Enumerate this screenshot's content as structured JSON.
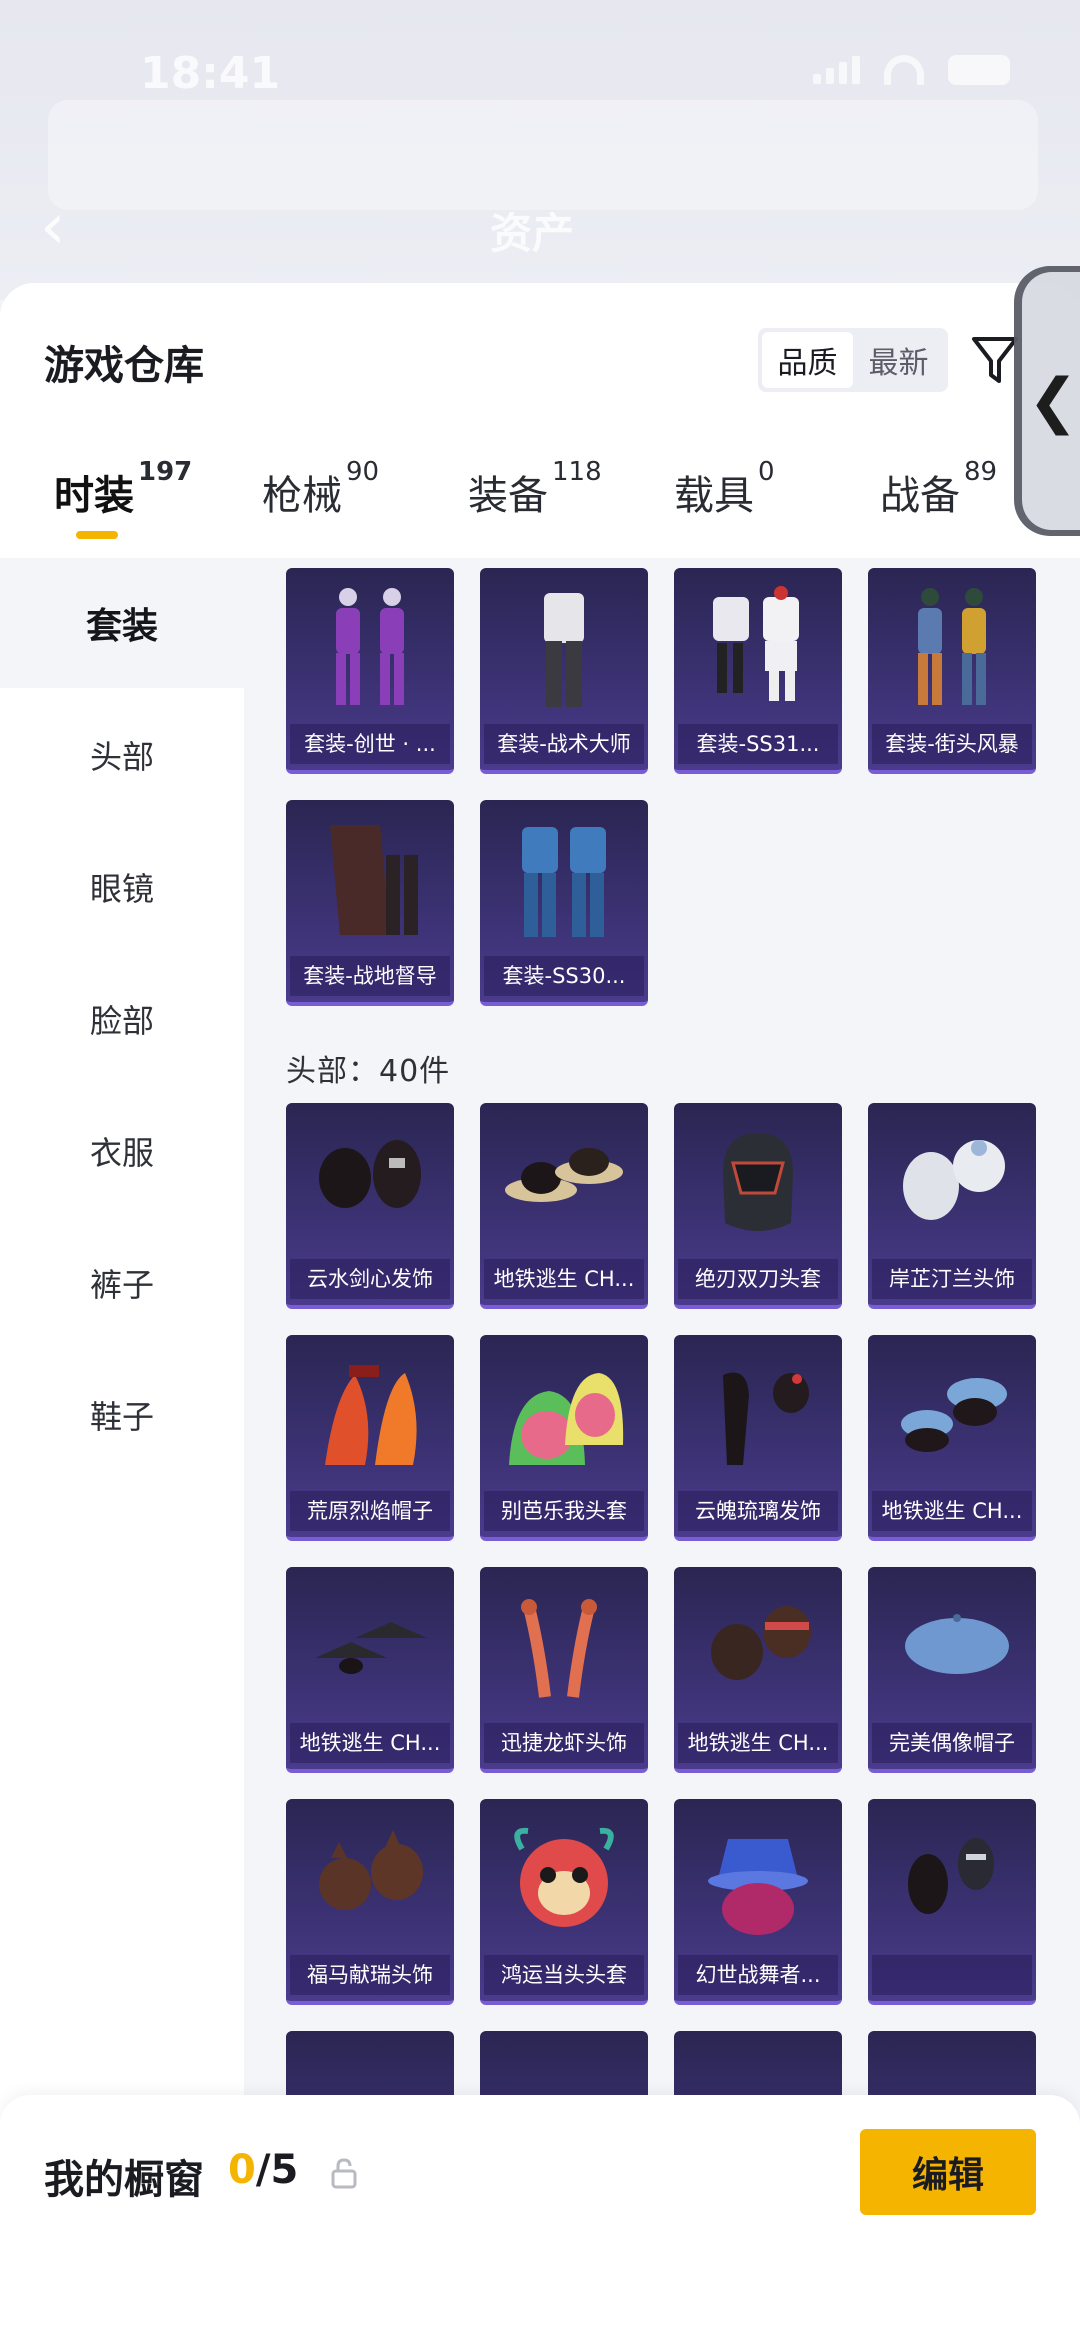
{
  "status_bar": {
    "time": "18:41"
  },
  "background_header": {
    "title": "资产"
  },
  "sheet": {
    "title": "游戏仓库",
    "sort_options": [
      "品质",
      "最新"
    ],
    "active_sort": "品质"
  },
  "tabs": [
    {
      "label": "时装",
      "count": "197"
    },
    {
      "label": "枪械",
      "count": "90"
    },
    {
      "label": "装备",
      "count": "118"
    },
    {
      "label": "载具",
      "count": "0"
    },
    {
      "label": "战备",
      "count": "89"
    }
  ],
  "categories": [
    "套装",
    "头部",
    "眼镜",
    "脸部",
    "衣服",
    "裤子",
    "鞋子"
  ],
  "suits": [
    {
      "name": "套装-创世 · ..."
    },
    {
      "name": "套装-战术大师"
    },
    {
      "name": "套装-SS31..."
    },
    {
      "name": "套装-街头风暴"
    },
    {
      "name": "套装-战地督导"
    },
    {
      "name": "套装-SS30..."
    }
  ],
  "head_section_label": "头部：40件",
  "head_items": [
    {
      "name": "云水剑心发饰"
    },
    {
      "name": "地铁逃生 CH..."
    },
    {
      "name": "绝刃双刀头套"
    },
    {
      "name": "岸芷汀兰头饰"
    },
    {
      "name": "荒原烈焰帽子"
    },
    {
      "name": "别芭乐我头套"
    },
    {
      "name": "云魄琉璃发饰"
    },
    {
      "name": "地铁逃生 CH..."
    },
    {
      "name": "地铁逃生 CH..."
    },
    {
      "name": "迅捷龙虾头饰"
    },
    {
      "name": "地铁逃生 CH..."
    },
    {
      "name": "完美偶像帽子"
    },
    {
      "name": "福马献瑞头饰"
    },
    {
      "name": "鸿运当头头套"
    },
    {
      "name": "幻世战舞者..."
    },
    {
      "name": ""
    }
  ],
  "bottom_bar": {
    "title": "我的橱窗",
    "used": "0",
    "total": "/5",
    "edit_label": "编辑"
  },
  "colors": {
    "accent": "#f5b400",
    "card_bg": "#3b3172"
  }
}
